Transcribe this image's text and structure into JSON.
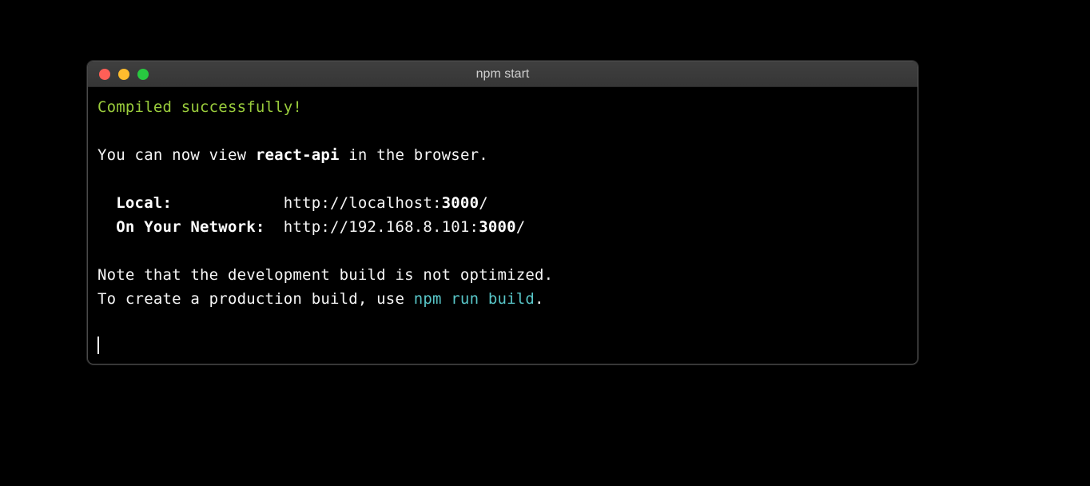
{
  "window": {
    "title": "npm start"
  },
  "output": {
    "compiled": "Compiled successfully!",
    "view_prefix": "You can now view ",
    "app_name": "react-api",
    "view_suffix": " in the browser.",
    "local_label": "  Local:            ",
    "local_url_prefix": "http://localhost:",
    "local_port": "3000",
    "local_url_suffix": "/",
    "network_label": "  On Your Network:  ",
    "network_url_prefix": "http://192.168.8.101:",
    "network_port": "3000",
    "network_url_suffix": "/",
    "note_line": "Note that the development build is not optimized.",
    "build_prefix": "To create a production build, use ",
    "build_cmd": "npm run build",
    "build_suffix": "."
  }
}
